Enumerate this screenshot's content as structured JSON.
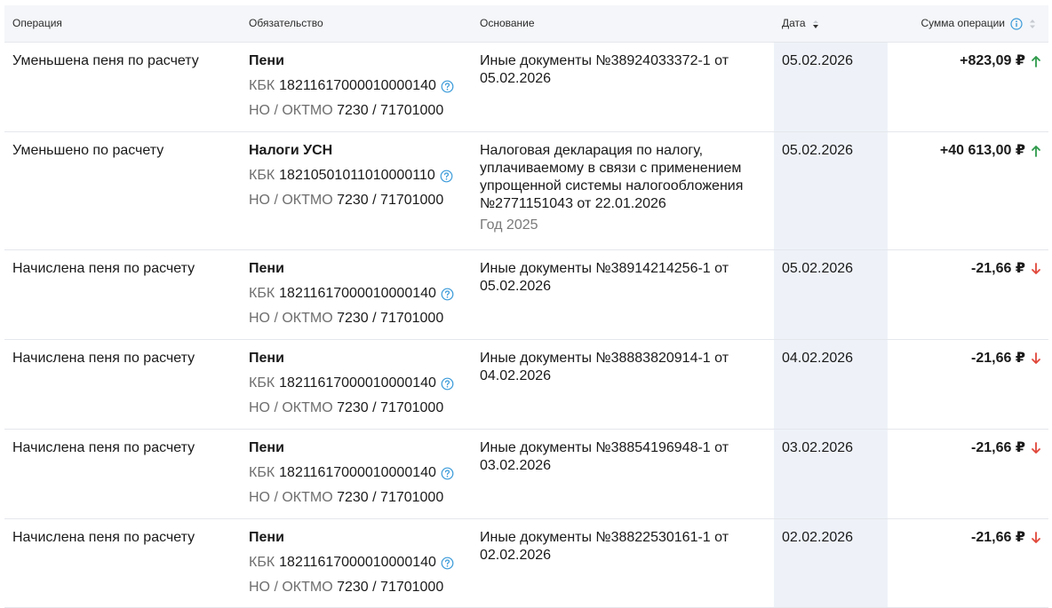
{
  "header": {
    "operation": "Операция",
    "obligation": "Обязательство",
    "basis": "Основание",
    "date": "Дата",
    "amount": "Сумма операции"
  },
  "labels": {
    "kbk_prefix": "КБК",
    "oktmo_prefix": "НО / ОКТМО"
  },
  "colors": {
    "up": "#2e9a4a",
    "down": "#e0473a",
    "info": "#3a9ad9"
  },
  "rows": [
    {
      "operation": "Уменьшена пеня по расчету",
      "obligation": "Пени",
      "kbk": "18211617000010000140",
      "no_oktmo": "7230 / 71701000",
      "basis": "Иные документы №38924033372-1 от 05.02.2026",
      "year": "",
      "date": "05.02.2026",
      "amount": "+823,09 ₽",
      "direction": "up"
    },
    {
      "operation": "Уменьшено по расчету",
      "obligation": "Налоги УСН",
      "kbk": "18210501011010000110",
      "no_oktmo": "7230 / 71701000",
      "basis": "Налоговая декларация по налогу, уплачиваемому в связи с применением упрощенной системы налогообложения №2771151043 от 22.01.2026",
      "year": "Год 2025",
      "date": "05.02.2026",
      "amount": "+40 613,00 ₽",
      "direction": "up"
    },
    {
      "operation": "Начислена пеня по расчету",
      "obligation": "Пени",
      "kbk": "18211617000010000140",
      "no_oktmo": "7230 / 71701000",
      "basis": "Иные документы №38914214256-1 от 05.02.2026",
      "year": "",
      "date": "05.02.2026",
      "amount": "-21,66 ₽",
      "direction": "down"
    },
    {
      "operation": "Начислена пеня по расчету",
      "obligation": "Пени",
      "kbk": "18211617000010000140",
      "no_oktmo": "7230 / 71701000",
      "basis": "Иные документы №38883820914-1 от 04.02.2026",
      "year": "",
      "date": "04.02.2026",
      "amount": "-21,66 ₽",
      "direction": "down"
    },
    {
      "operation": "Начислена пеня по расчету",
      "obligation": "Пени",
      "kbk": "18211617000010000140",
      "no_oktmo": "7230 / 71701000",
      "basis": "Иные документы №38854196948-1 от 03.02.2026",
      "year": "",
      "date": "03.02.2026",
      "amount": "-21,66 ₽",
      "direction": "down"
    },
    {
      "operation": "Начислена пеня по расчету",
      "obligation": "Пени",
      "kbk": "18211617000010000140",
      "no_oktmo": "7230 / 71701000",
      "basis": "Иные документы №38822530161-1 от 02.02.2026",
      "year": "",
      "date": "02.02.2026",
      "amount": "-21,66 ₽",
      "direction": "down"
    }
  ]
}
